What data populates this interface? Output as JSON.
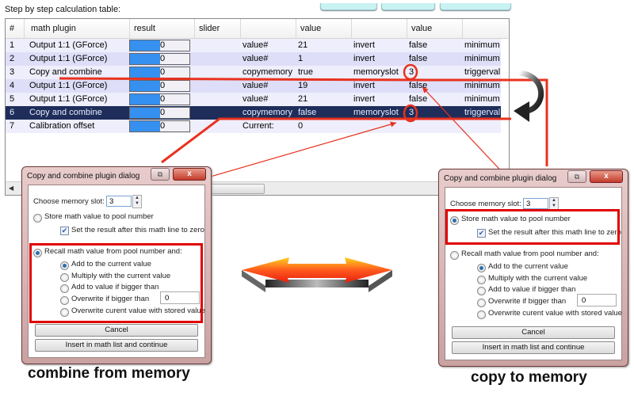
{
  "caption": "Step by step calculation table:",
  "table": {
    "headers": [
      "#",
      "math plugin",
      "result",
      "slider",
      "",
      "value",
      "",
      "value",
      ""
    ],
    "rows": [
      {
        "num": "1",
        "plugin": "Output 1:1 (GForce)",
        "result": "0",
        "result_fill": 0.5,
        "p1": "value#",
        "v1": "21",
        "p2": "invert",
        "v2": "false",
        "p3": "minimum",
        "style": "odd"
      },
      {
        "num": "2",
        "plugin": "Output 1:1 (GForce)",
        "result": "0",
        "result_fill": 0.5,
        "p1": "value#",
        "v1": "1",
        "p2": "invert",
        "v2": "false",
        "p3": "minimum",
        "style": "even"
      },
      {
        "num": "3",
        "plugin": "Copy and combine",
        "result": "0",
        "result_fill": 0.5,
        "p1": "copymemory",
        "v1": "true",
        "p2": "memoryslot",
        "v2": "3",
        "p3": "triggerval",
        "style": "odd"
      },
      {
        "num": "4",
        "plugin": "Output 1:1 (GForce)",
        "result": "0",
        "result_fill": 0.5,
        "p1": "value#",
        "v1": "19",
        "p2": "invert",
        "v2": "false",
        "p3": "minimum",
        "style": "even"
      },
      {
        "num": "5",
        "plugin": "Output 1:1 (GForce)",
        "result": "0",
        "result_fill": 0.5,
        "p1": "value#",
        "v1": "21",
        "p2": "invert",
        "v2": "false",
        "p3": "minimum",
        "style": "odd"
      },
      {
        "num": "6",
        "plugin": "Copy and combine",
        "result": "0",
        "result_fill": 0.5,
        "p1": "copymemory",
        "v1": "false",
        "p2": "memoryslot",
        "v2": "3",
        "p3": "triggerval",
        "style": "sel"
      },
      {
        "num": "7",
        "plugin": "Calibration offset",
        "result": "0",
        "result_fill": 0.5,
        "p1": "Current:",
        "v1": "0",
        "p2": "",
        "v2": "",
        "p3": "",
        "style": "odd"
      }
    ]
  },
  "dialogs": [
    {
      "id": "combine",
      "title": "Copy and combine plugin dialog",
      "restore_glyph": "⧉",
      "close_glyph": "x",
      "slot_label": "Choose memory slot:",
      "slot_value": "3",
      "store_label": "Store math value to pool number",
      "store_selected": false,
      "zero_label": "Set the result after this math line to zero",
      "zero_checked": true,
      "recall_label": "Recall math value from pool number and:",
      "recall_selected": true,
      "options": [
        "Add to the current value",
        "Multiply with the current value",
        "Add to value if bigger than",
        "Overwrite if bigger than",
        "Overwrite curent value with stored value"
      ],
      "option_selected": 0,
      "threshold_value": "0",
      "cancel_label": "Cancel",
      "insert_label": "Insert in math list and continue",
      "caption": "combine from memory"
    },
    {
      "id": "copy",
      "title": "Copy and combine plugin dialog",
      "restore_glyph": "⧉",
      "close_glyph": "x",
      "slot_label": "Choose memory slot:",
      "slot_value": "3",
      "store_label": "Store math value to pool number",
      "store_selected": true,
      "zero_label": "Set the result after this math line to zero",
      "zero_checked": true,
      "recall_label": "Recall math value from pool number and:",
      "recall_selected": false,
      "options": [
        "Add to the current value",
        "Multiply with the current value",
        "Add to value if bigger than",
        "Overwrite if bigger than",
        "Overwrite curent value with stored value"
      ],
      "option_selected": 0,
      "threshold_value": "0",
      "cancel_label": "Cancel",
      "insert_label": "Insert in math list and continue",
      "caption": "copy to memory"
    }
  ],
  "colors": {
    "annotation_red": "#e8321e",
    "highlight_box": "#e00000",
    "selected_row": "#1e2d5a",
    "result_bar": "#3590f0"
  },
  "icons": {
    "double_arrow": "double-headed-arrow",
    "curved_arrow": "curved-down-arrow"
  }
}
